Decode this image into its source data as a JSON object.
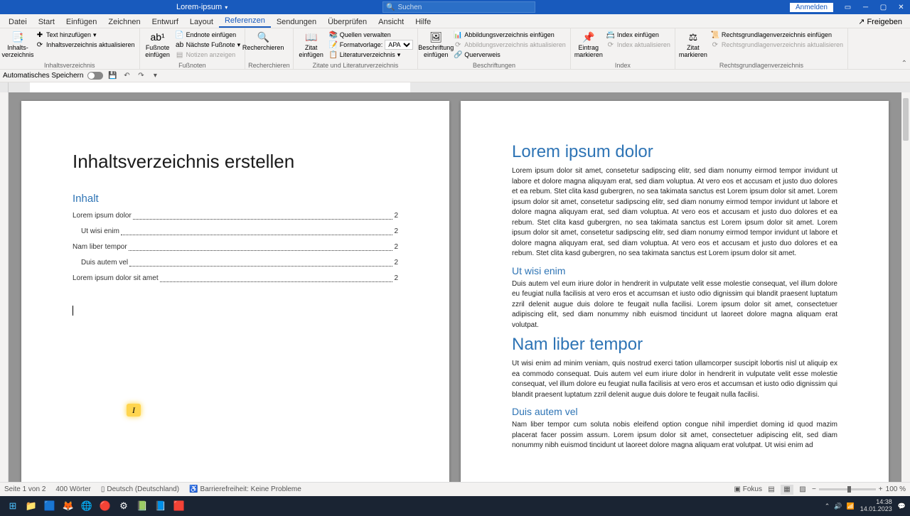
{
  "titlebar": {
    "doc": "Lorem-ipsum",
    "search_placeholder": "Suchen",
    "signin": "Anmelden"
  },
  "tabs": {
    "datei": "Datei",
    "start": "Start",
    "einfuegen": "Einfügen",
    "zeichnen": "Zeichnen",
    "entwurf": "Entwurf",
    "layout": "Layout",
    "referenzen": "Referenzen",
    "sendungen": "Sendungen",
    "ueberpruefen": "Überprüfen",
    "ansicht": "Ansicht",
    "hilfe": "Hilfe",
    "share": "Freigeben"
  },
  "ribbon": {
    "toc": {
      "btn": "Inhalts-verzeichnis",
      "add_text": "Text hinzufügen",
      "update": "Inhaltsverzeichnis aktualisieren",
      "label": "Inhaltsverzeichnis"
    },
    "footnotes": {
      "btn": "Fußnote einfügen",
      "endnote": "Endnote einfügen",
      "next": "Nächste Fußnote",
      "show": "Notizen anzeigen",
      "label": "Fußnoten"
    },
    "research": {
      "btn": "Recherchieren",
      "label": "Recherchieren"
    },
    "citations": {
      "btn": "Zitat einfügen",
      "manage": "Quellen verwalten",
      "style_label": "Formatvorlage:",
      "style_value": "APA",
      "biblio": "Literaturverzeichnis",
      "label": "Zitate und Literaturverzeichnis"
    },
    "captions": {
      "btn": "Beschriftung einfügen",
      "insert_fig": "Abbildungsverzeichnis einfügen",
      "update_fig": "Abbildungsverzeichnis aktualisieren",
      "crossref": "Querverweis",
      "label": "Beschriftungen"
    },
    "index": {
      "btn": "Eintrag markieren",
      "insert": "Index einfügen",
      "update": "Index aktualisieren",
      "label": "Index"
    },
    "legal": {
      "btn": "Zitat markieren",
      "insert": "Rechtsgrundlagenverzeichnis einfügen",
      "update": "Rechtsgrundlagenverzeichnis aktualisieren",
      "label": "Rechtsgrundlagenverzeichnis"
    }
  },
  "qat": {
    "autosave": "Automatisches Speichern"
  },
  "doc": {
    "title": "Inhaltsverzeichnis erstellen",
    "toc_heading": "Inhalt",
    "toc": [
      {
        "level": 1,
        "text": "Lorem ipsum dolor",
        "page": "2"
      },
      {
        "level": 2,
        "text": "Ut wisi enim",
        "page": "2"
      },
      {
        "level": 1,
        "text": "Nam liber tempor",
        "page": "2"
      },
      {
        "level": 2,
        "text": "Duis autem vel",
        "page": "2"
      },
      {
        "level": 1,
        "text": "Lorem ipsum dolor sit amet",
        "page": "2"
      }
    ],
    "p2": {
      "h1": "Lorem ipsum dolor",
      "p1": "Lorem ipsum dolor sit amet, consetetur sadipscing elitr, sed diam nonumy eirmod tempor invidunt ut labore et dolore magna aliquyam erat, sed diam voluptua. At vero eos et accusam et justo duo dolores et ea rebum. Stet clita kasd gubergren, no sea takimata sanctus est Lorem ipsum dolor sit amet. Lorem ipsum dolor sit amet, consetetur sadipscing elitr, sed diam nonumy eirmod tempor invidunt ut labore et dolore magna aliquyam erat, sed diam voluptua. At vero eos et accusam et justo duo dolores et ea rebum. Stet clita kasd gubergren, no sea takimata sanctus est Lorem ipsum dolor sit amet. Lorem ipsum dolor sit amet, consetetur sadipscing elitr, sed diam nonumy eirmod tempor invidunt ut labore et dolore magna aliquyam erat, sed diam voluptua. At vero eos et accusam et justo duo dolores et ea rebum. Stet clita kasd gubergren, no sea takimata sanctus est Lorem ipsum dolor sit amet.",
      "h2": "Ut wisi enim",
      "p2": "Duis autem vel eum iriure dolor in hendrerit in vulputate velit esse molestie consequat, vel illum dolore eu feugiat nulla facilisis at vero eros et accumsan et iusto odio dignissim qui blandit praesent luptatum zzril delenit augue duis dolore te feugait nulla facilisi. Lorem ipsum dolor sit amet, consectetuer adipiscing elit, sed diam nonummy nibh euismod tincidunt ut laoreet dolore magna aliquam erat volutpat.",
      "h3": "Nam liber tempor",
      "p3": "Ut wisi enim ad minim veniam, quis nostrud exerci tation ullamcorper suscipit lobortis nisl ut aliquip ex ea commodo consequat. Duis autem vel eum iriure dolor in hendrerit in vulputate velit esse molestie consequat, vel illum dolore eu feugiat nulla facilisis at vero eros et accumsan et iusto odio dignissim qui blandit praesent luptatum zzril delenit augue duis dolore te feugait nulla facilisi.",
      "h4": "Duis autem vel",
      "p4": "Nam liber tempor cum soluta nobis eleifend option congue nihil imperdiet doming id quod mazim placerat facer possim assum. Lorem ipsum dolor sit amet, consectetuer adipiscing elit, sed diam nonummy nibh euismod tincidunt ut laoreet dolore magna aliquam erat volutpat. Ut wisi enim ad"
    }
  },
  "status": {
    "page": "Seite 1 von 2",
    "words": "400 Wörter",
    "lang": "Deutsch (Deutschland)",
    "access": "Barrierefreiheit: Keine Probleme",
    "focus": "Fokus",
    "zoom": "100 %"
  },
  "taskbar": {
    "time": "14:38",
    "date": "14.01.2023"
  }
}
